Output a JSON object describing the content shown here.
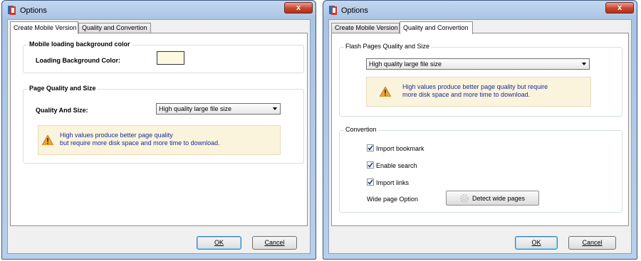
{
  "windows": {
    "left": {
      "title": "Options",
      "close_label": "x",
      "tabs": [
        "Create Mobile Version",
        "Quality and Convertion"
      ],
      "group_bg": {
        "label": "Mobile loading background color",
        "field_label": "Loading Background Color:",
        "color": "#fff9e0"
      },
      "group_quality": {
        "label": "Page Quality and Size",
        "field_label": "Quality And Size:",
        "selected": "High quality large file size",
        "note_line1": "High values produce better page quality",
        "note_line2": "but require more disk space and more time to download."
      },
      "ok_label": "OK",
      "cancel_label": "Cancel"
    },
    "right": {
      "title": "Options",
      "close_label": "x",
      "tabs": [
        "Create Mobile Version",
        "Quality and Convertion"
      ],
      "group_flash": {
        "label": "Flash Pages Quality and Size",
        "selected": "High quality large file size",
        "note_line1": "High values produce better page quality but require",
        "note_line2": "more disk space and more time to download."
      },
      "group_convertion": {
        "label": "Convertion",
        "checkboxes": [
          {
            "label": "Import bookmark",
            "checked": true
          },
          {
            "label": "Enable search",
            "checked": true
          },
          {
            "label": "Import links",
            "checked": true
          }
        ],
        "wide_label": "Wide page Option",
        "detect_label": "Detect wide pages"
      },
      "ok_label": "OK",
      "cancel_label": "Cancel"
    }
  },
  "colors": {
    "note_text": "#1a2a9a",
    "note_bg": "#fbf4dc",
    "warning": "#e8a43a"
  },
  "icons": {
    "app": "options-app-icon",
    "warning": "warning-triangle-icon",
    "gear": "gear-icon",
    "check": "checkmark-icon"
  }
}
